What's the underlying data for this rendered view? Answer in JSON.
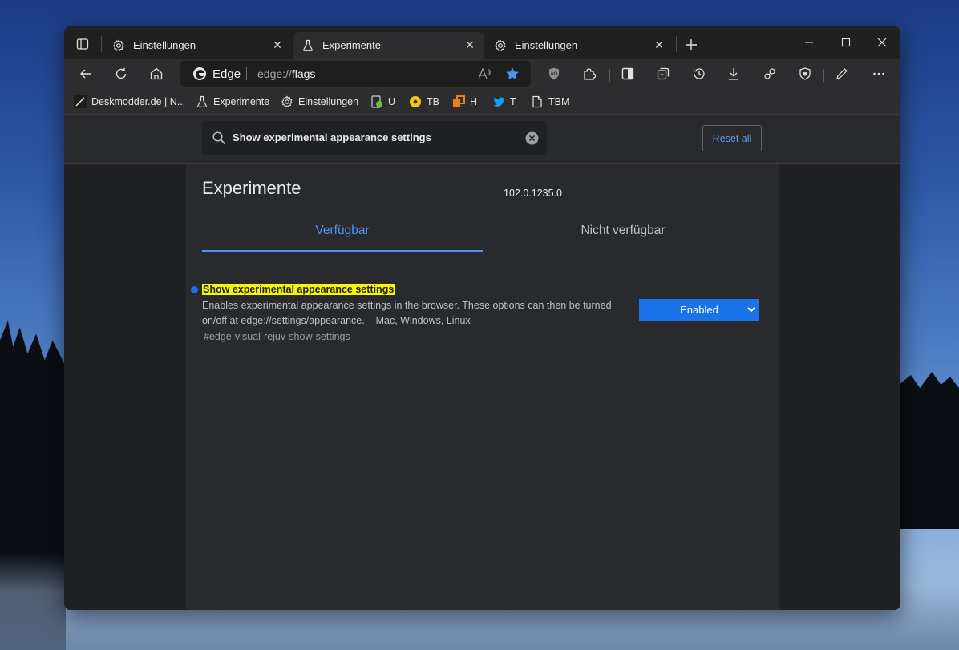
{
  "tabs": [
    {
      "title": "Einstellungen",
      "icon": "gear-icon",
      "active": false
    },
    {
      "title": "Experimente",
      "icon": "flask-icon",
      "active": true
    },
    {
      "title": "Einstellungen",
      "icon": "gear-icon",
      "active": false
    }
  ],
  "tab_close_glyph": "✕",
  "omnibox": {
    "browser_label": "Edge",
    "url_prefix": "edge://",
    "url_path": "flags"
  },
  "favorites": [
    {
      "label": "Deskmodder.de | N...",
      "icon": "deskmodder-icon"
    },
    {
      "label": "Experimente",
      "icon": "flask-icon"
    },
    {
      "label": "Einstellungen",
      "icon": "gear-icon"
    },
    {
      "label": "U",
      "icon": "u-bookmark-icon"
    },
    {
      "label": "TB",
      "icon": "tb-bookmark-icon"
    },
    {
      "label": "H",
      "icon": "h-bookmark-icon"
    },
    {
      "label": "T",
      "icon": "twitter-icon"
    },
    {
      "label": "TBM",
      "icon": "page-icon"
    }
  ],
  "flags": {
    "search_value": "Show experimental appearance settings",
    "reset_label": "Reset all",
    "page_title": "Experimente",
    "version": "102.0.1235.0",
    "tab_available": "Verfügbar",
    "tab_unavailable": "Nicht verfügbar",
    "experiment": {
      "name": "Show experimental appearance settings",
      "description": "Enables experimental appearance settings in the browser. These options can then be turned on/off at edge://settings/appearance. – Mac, Windows, Linux",
      "link": "#edge-visual-rejuv-show-settings",
      "state": "Enabled"
    }
  },
  "colors": {
    "accent": "#1a73e8",
    "highlight": "#f7f50a",
    "link_blue": "#4d94ef"
  }
}
